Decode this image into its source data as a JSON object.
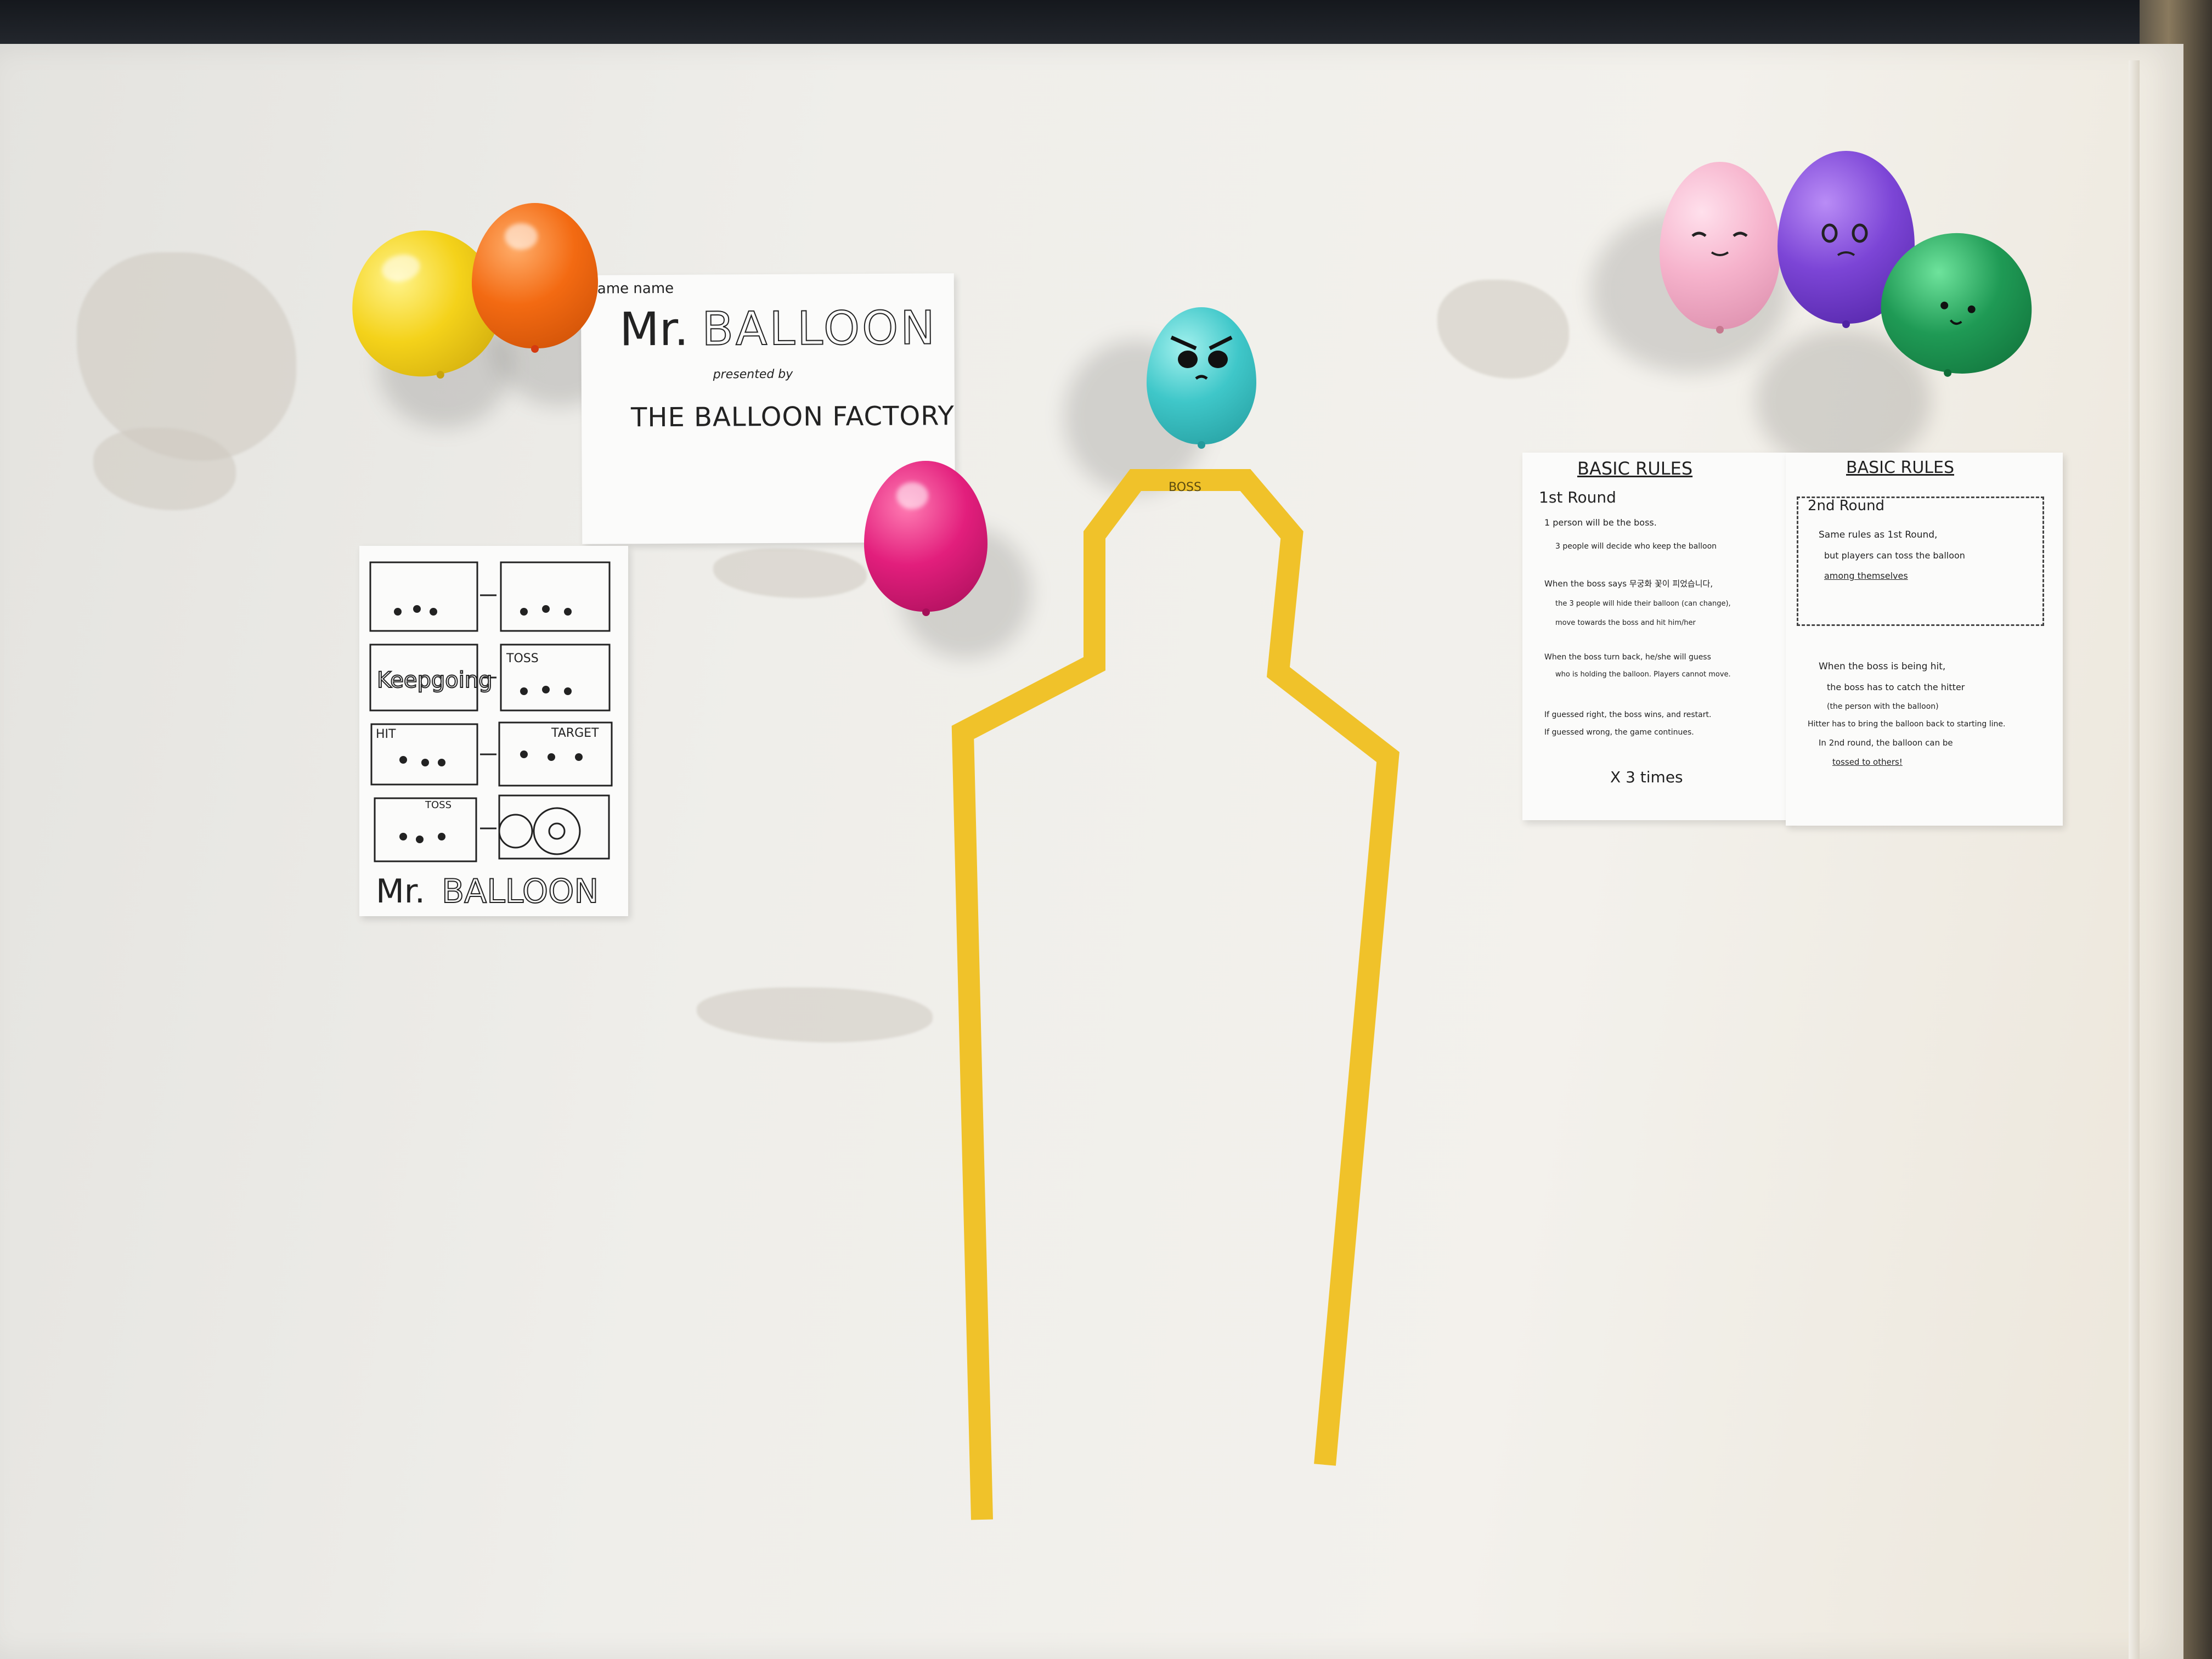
{
  "title_poster": {
    "label": "ame name",
    "title_mr": "Mr.",
    "title_balloon": "BALLOON",
    "presented": "presented by",
    "studio": "THE BALLOON FACTORY"
  },
  "storyboard": {
    "panel_keep": "Keepgoing",
    "panel_toss": "TOSS",
    "panel_hit": "HIT",
    "panel_target": "TARGET",
    "panel_toss2": "TOSS",
    "footer_mr": "Mr.",
    "footer_balloon": "BALLOON"
  },
  "tape_figure": {
    "label": "BOSS"
  },
  "rules_left": {
    "heading": "BASIC RULES",
    "round": "1st Round",
    "r1": "1 person will be the boss.",
    "r1b": "3 people will decide who keep the balloon",
    "r2": "When the boss says 무궁화 꽃이 피었습니다,",
    "r2b": "the 3 people will hide their balloon (can change),",
    "r2c": "move towards the boss and hit him/her",
    "r3": "When the boss turn back, he/she will guess",
    "r3b": "who is holding the balloon. Players cannot move.",
    "r4": "If guessed right, the boss wins, and restart.",
    "r4b": "If guessed wrong, the game continues.",
    "times": "X 3 times"
  },
  "rules_right": {
    "heading": "BASIC RULES",
    "round": "2nd Round",
    "s1": "Same rules as 1st Round,",
    "s1b": "but players can toss the balloon",
    "s1c": "among themselves",
    "s2": "When the boss is being hit,",
    "s2b": "the boss has to catch the hitter",
    "s2c": "(the person with the balloon)",
    "s3": "Hitter has to bring the balloon back to starting line.",
    "s4": "In 2nd round, the balloon can be",
    "s4b": "tossed to others!"
  },
  "colors": {
    "yellow_balloon": "#f4d21a",
    "orange_balloon": "#f36a12",
    "magenta_balloon": "#e21e7c",
    "cyan_balloon": "#3fc7c9",
    "pink_balloon": "#f6b3cc",
    "purple_balloon": "#7c45d6",
    "green_balloon": "#1f9a55",
    "tape": "#f0c22a"
  }
}
